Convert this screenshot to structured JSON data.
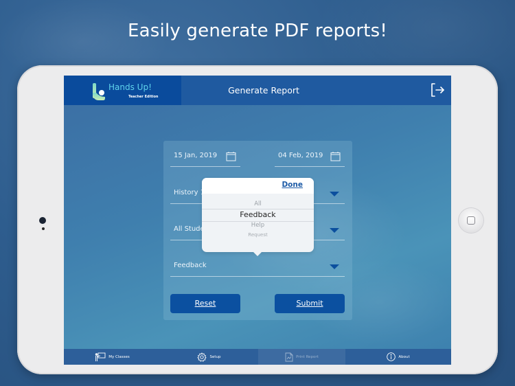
{
  "headline": "Easily generate PDF reports!",
  "app": {
    "brand_name": "Hands Up!",
    "brand_subtitle": "Teacher Edition",
    "title": "Generate Report",
    "colors": {
      "brand_bg": "#0a4b9c",
      "topbar_bg": "#1f5aa0",
      "accent": "#0b50a0",
      "brand_text": "#5fd3ec",
      "tabbar_bg": "#2d5f9a"
    }
  },
  "form": {
    "start_date": "15 Jan, 2019",
    "end_date": "04 Feb, 2019",
    "class_select": "History 1",
    "student_select": "All Students",
    "type_select": "Feedback",
    "reset_label": "Reset",
    "submit_label": "Submit"
  },
  "picker": {
    "done_label": "Done",
    "options": [
      "All",
      "Feedback",
      "Help",
      "Request"
    ],
    "selected": "Feedback"
  },
  "tabbar": {
    "items": [
      {
        "label": "My Classes",
        "icon": "teacher-board-icon",
        "enabled": true
      },
      {
        "label": "Setup",
        "icon": "gear-icon",
        "enabled": true
      },
      {
        "label": "Print Report",
        "icon": "report-document-icon",
        "enabled": false
      },
      {
        "label": "About",
        "icon": "info-icon",
        "enabled": true
      }
    ]
  }
}
